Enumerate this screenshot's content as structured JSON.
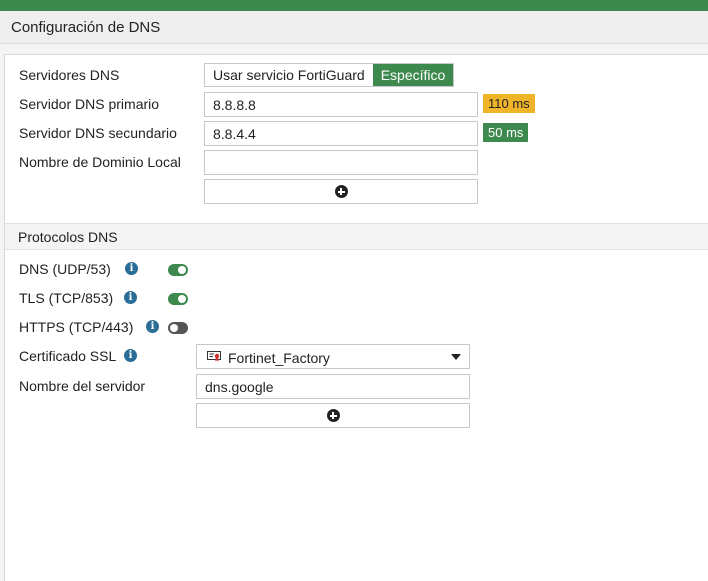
{
  "header": {
    "title": "Configuración de DNS"
  },
  "dns_servers": {
    "label": "Servidores DNS",
    "options": [
      "Usar servicio FortiGuard",
      "Específico"
    ],
    "selected": "Específico"
  },
  "primary": {
    "label": "Servidor DNS primario",
    "value": "8.8.8.8",
    "latency": "110 ms",
    "latency_color": "#f0b429"
  },
  "secondary": {
    "label": "Servidor DNS secundario",
    "value": "8.8.4.4",
    "latency": "50 ms",
    "latency_color": "#3e8a4e"
  },
  "local_domain": {
    "label": "Nombre de Dominio Local",
    "value": ""
  },
  "protocols": {
    "title": "Protocolos DNS",
    "items": [
      {
        "label": "DNS (UDP/53)",
        "enabled": true
      },
      {
        "label": "TLS (TCP/853)",
        "enabled": true
      },
      {
        "label": "HTTPS (TCP/443)",
        "enabled": false
      }
    ]
  },
  "ssl_cert": {
    "label": "Certificado SSL",
    "value": "Fortinet_Factory"
  },
  "server_name": {
    "label": "Nombre del servidor",
    "value": "dns.google"
  },
  "icons": {
    "info": "info-icon",
    "add": "plus-circle-icon",
    "cert": "certificate-icon",
    "dropdown": "caret-down-icon"
  },
  "colors": {
    "accent": "#3e8a4e",
    "info": "#2a6d97"
  }
}
